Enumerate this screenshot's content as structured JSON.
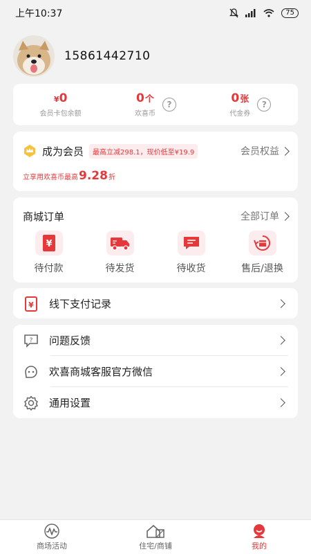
{
  "status_bar": {
    "time": "上午10:37",
    "battery": "75"
  },
  "profile": {
    "phone": "15861442710"
  },
  "wallet": {
    "balance_prefix": "¥",
    "balance_value": "0",
    "balance_label": "会员卡包余额",
    "coins_value": "0",
    "coins_unit": "个",
    "coins_label": "欢喜币",
    "coupons_value": "0",
    "coupons_unit": "张",
    "coupons_label": "代金券",
    "help_glyph": "?"
  },
  "member": {
    "title": "成为会员",
    "promo": "最高立减298.1，现价低至¥19.9",
    "link": "会员权益",
    "desc_prefix": "立享用欢喜币最高",
    "desc_number": "9.28",
    "desc_suffix": "折"
  },
  "orders": {
    "title": "商城订单",
    "all_link": "全部订单",
    "items": [
      {
        "label": "待付款",
        "icon": "yen-icon"
      },
      {
        "label": "待发货",
        "icon": "truck-icon"
      },
      {
        "label": "待收货",
        "icon": "message-icon"
      },
      {
        "label": "售后/退换",
        "icon": "return-icon"
      }
    ]
  },
  "offline": {
    "label": "线下支付记录"
  },
  "settings": {
    "items": [
      {
        "label": "问题反馈"
      },
      {
        "label": "欢喜商城客服官方微信"
      },
      {
        "label": "通用设置"
      }
    ]
  },
  "tabbar": {
    "items": [
      {
        "label": "商场活动"
      },
      {
        "label": "住宅/商铺"
      },
      {
        "label": "我的"
      }
    ]
  },
  "colors": {
    "accent": "#e5383b",
    "background": "#f2f2f2"
  }
}
